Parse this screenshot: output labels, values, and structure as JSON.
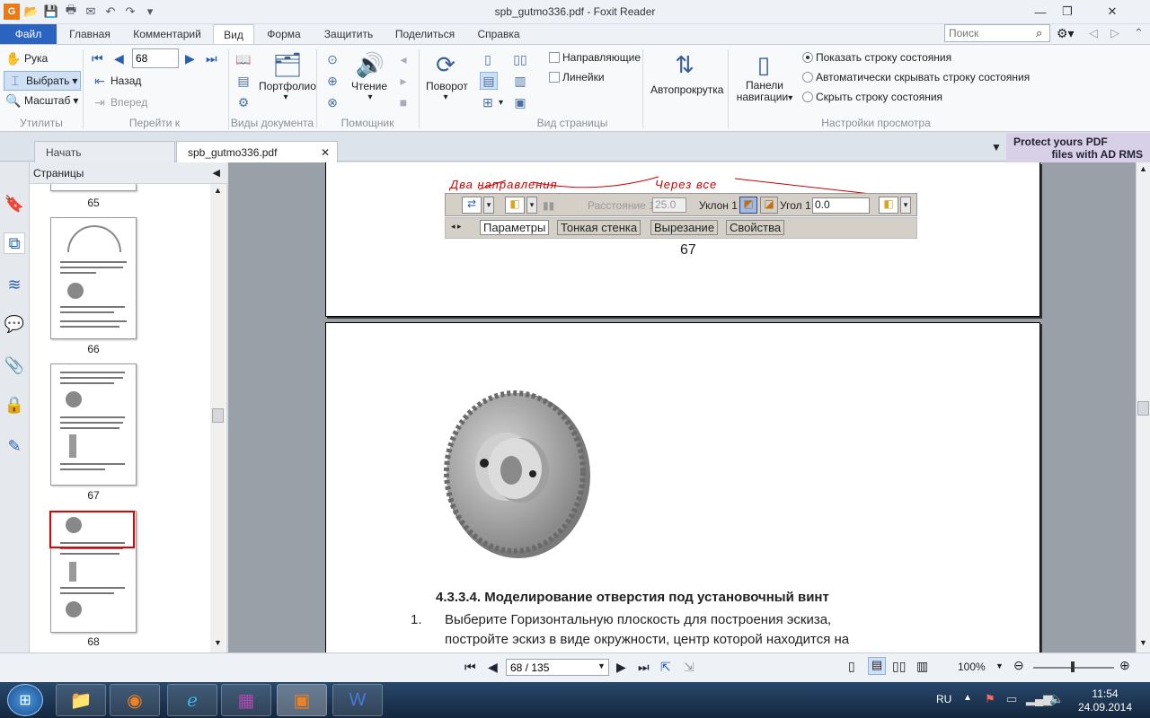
{
  "window": {
    "title": "spb_gutmo336.pdf - Foxit Reader"
  },
  "ribbon_tabs": [
    {
      "label": "Файл"
    },
    {
      "label": "Главная"
    },
    {
      "label": "Комментарий"
    },
    {
      "label": "Вид"
    },
    {
      "label": "Форма"
    },
    {
      "label": "Защитить"
    },
    {
      "label": "Поделиться"
    },
    {
      "label": "Справка"
    }
  ],
  "search": {
    "placeholder": "Поиск"
  },
  "ribbon": {
    "utilities": {
      "hand": "Рука",
      "select": "Выбрать",
      "zoom": "Масштаб",
      "label": "Утилиты"
    },
    "goto": {
      "page_value": "68",
      "back": "Назад",
      "forward": "Вперед",
      "label": "Перейти к"
    },
    "docviews": {
      "portfolio": "Портфолио",
      "label": "Виды документа"
    },
    "assistant": {
      "reading": "Чтение",
      "label": "Помощник"
    },
    "pageview": {
      "rotate": "Поворот",
      "guides": "Направляющие",
      "rulers": "Линейки",
      "label": "Вид страницы"
    },
    "autoscroll": {
      "label": "Автопрокрутка"
    },
    "navpanels": {
      "line1": "Панели",
      "line2": "навигации"
    },
    "viewsettings": {
      "opt1": "Показать строку состояния",
      "opt2": "Автоматически скрывать строку состояния",
      "opt3": "Скрыть строку состояния",
      "label": "Настройки просмотра"
    }
  },
  "doc_tabs": [
    {
      "label": "Начать"
    },
    {
      "label": "spb_gutmo336.pdf"
    }
  ],
  "rms": {
    "line1": "Protect yours PDF",
    "line2": "files with AD RMS"
  },
  "panel": {
    "title": "Страницы",
    "pages": [
      "65",
      "66",
      "67",
      "68"
    ]
  },
  "page_content": {
    "annot1": "Два направления",
    "annot2": "Через все",
    "toolbar_dist": "Расстояние 1",
    "toolbar_dist_val": "25.0",
    "toolbar_slope": "Уклон 1",
    "toolbar_angle": "Угол 1",
    "toolbar_angle_val": "0.0",
    "tabs": [
      "Параметры",
      "Тонкая стенка",
      "Вырезание",
      "Свойства"
    ],
    "page_number": "67",
    "heading": "4.3.3.4. Моделирование отверстия под установочный винт",
    "item_no": "1.",
    "para1": "Выберите Горизонтальную плоскость для построения эскиза,",
    "para2": "постройте эскиз в виде окружности, центр которой находится на"
  },
  "status": {
    "page": "68 / 135",
    "zoom": "100%"
  },
  "taskbar": {
    "lang": "RU",
    "time": "11:54",
    "date": "24.09.2014"
  },
  "colors": {
    "accent": "#2b63c0",
    "annotation": "#cc0000",
    "thumb_select": "#e00000"
  }
}
